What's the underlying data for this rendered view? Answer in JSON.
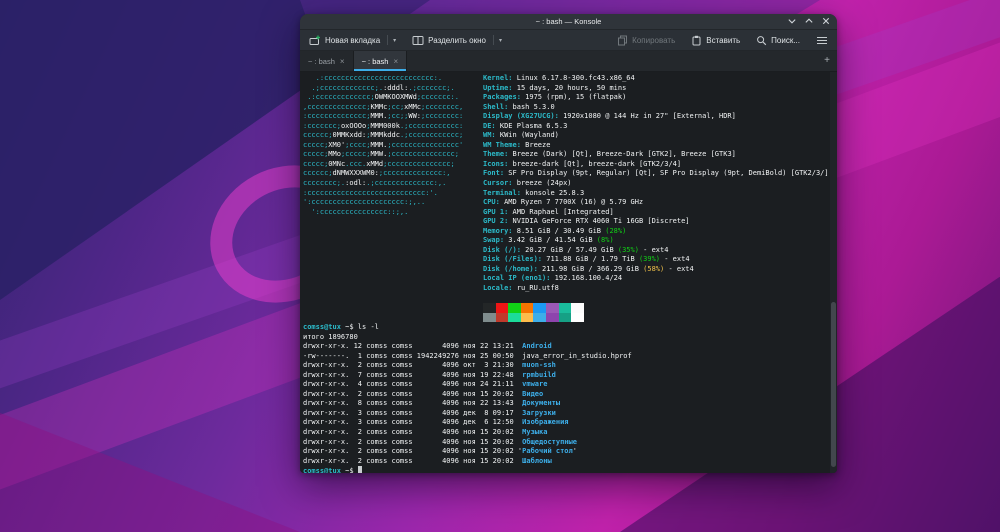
{
  "window": {
    "title": "~ : bash — Konsole"
  },
  "toolbar": {
    "new_tab": "Новая вкладка",
    "split": "Разделить окно",
    "copy": "Копировать",
    "paste": "Вставить",
    "search": "Поиск..."
  },
  "tabs": [
    {
      "label": "~ : bash"
    },
    {
      "label": "~ : bash"
    }
  ],
  "terminal": {
    "colors": {
      "c": "#2cbac9",
      "w": "#f2f4f5",
      "l": "#2cbac9",
      "g": "#11d116",
      "y": "#f0c24b",
      "d": "#3daee9",
      "p": "#2cbac9"
    },
    "palette": {
      "normal": [
        "#232627",
        "#ed1515",
        "#11d116",
        "#f67400",
        "#1d99f3",
        "#9b59b6",
        "#1abc9c",
        "#fcfcfc"
      ],
      "bright": [
        "#7f8c8d",
        "#c0392b",
        "#1cdc9a",
        "#fdbc4b",
        "#3daee9",
        "#8e44ad",
        "#16a085",
        "#ffffff"
      ]
    },
    "art": [
      [
        [
          "c",
          "   .:cccccccccccccccccccccccccc:."
        ]
      ],
      [
        [
          "c",
          "  .;ccccccccccccc;."
        ],
        [
          "w",
          ":dddl:"
        ],
        [
          "c",
          ".;ccccccc;."
        ]
      ],
      [
        [
          "c",
          " .:ccccccccccccc;"
        ],
        [
          "w",
          "OWMKOOXMWd"
        ],
        [
          "c",
          ";ccccccc:."
        ]
      ],
      [
        [
          "c",
          ",cccccccccccccc;"
        ],
        [
          "w",
          "KMMc"
        ],
        [
          "c",
          ";cc;"
        ],
        [
          "w",
          "xMMc"
        ],
        [
          "c",
          ";cccccccc,"
        ]
      ],
      [
        [
          "c",
          ":cccccccccccccc;"
        ],
        [
          "w",
          "MMM."
        ],
        [
          "c",
          ";cc;;"
        ],
        [
          "w",
          "WW:"
        ],
        [
          "c",
          ";cccccccc:"
        ]
      ],
      [
        [
          "c",
          ":ccccccc;"
        ],
        [
          "w",
          "oxOOOo"
        ],
        [
          "c",
          ";"
        ],
        [
          "w",
          "MMM000k"
        ],
        [
          "c",
          ".;cccccccccccc:"
        ]
      ],
      [
        [
          "c",
          "cccccc;"
        ],
        [
          "w",
          "0MMKxdd:"
        ],
        [
          "c",
          ";"
        ],
        [
          "w",
          "MMMkddc"
        ],
        [
          "c",
          ".;cccccccccccc;"
        ]
      ],
      [
        [
          "c",
          "ccccc;"
        ],
        [
          "w",
          "XM0'"
        ],
        [
          "c",
          ";cccc;"
        ],
        [
          "w",
          "MMM."
        ],
        [
          "c",
          ";cccccccccccccccc'"
        ]
      ],
      [
        [
          "c",
          "ccccc;"
        ],
        [
          "w",
          "MMo"
        ],
        [
          "c",
          ";ccccc;"
        ],
        [
          "w",
          "MMW."
        ],
        [
          "c",
          ";ccccccccccccccc;"
        ]
      ],
      [
        [
          "c",
          "ccccc;"
        ],
        [
          "w",
          "0MNc"
        ],
        [
          "c",
          ".ccc."
        ],
        [
          "w",
          "xMMd"
        ],
        [
          "c",
          ";ccccccccccccccc;"
        ]
      ],
      [
        [
          "c",
          "cccccc;"
        ],
        [
          "w",
          "dNMWXXXWM0:"
        ],
        [
          "c",
          ";cccccccccccccc:,"
        ]
      ],
      [
        [
          "c",
          "cccccccc;."
        ],
        [
          "w",
          ":odl:"
        ],
        [
          "c",
          ".;cccccccccccccc:,."
        ]
      ],
      [
        [
          "c",
          ":cccccccccccccccccccccccccccc:'."
        ]
      ],
      [
        [
          "c",
          "':cccccccccccccccccccccc:;,.."
        ]
      ],
      [
        [
          "c",
          "  ':cccccccccccccccc::;,."
        ]
      ]
    ],
    "info": [
      [
        [
          "l",
          "Kernel:"
        ],
        [
          "w",
          " Linux 6.17.8-300.fc43.x86_64"
        ]
      ],
      [
        [
          "l",
          "Uptime:"
        ],
        [
          "w",
          " 15 days, 20 hours, 50 mins"
        ]
      ],
      [
        [
          "l",
          "Packages:"
        ],
        [
          "w",
          " 1975 (rpm), 15 (flatpak)"
        ]
      ],
      [
        [
          "l",
          "Shell:"
        ],
        [
          "w",
          " bash 5.3.0"
        ]
      ],
      [
        [
          "l",
          "Display (XG27UCG):"
        ],
        [
          "w",
          " 1920x1080 @ 144 Hz in 27\" [External, HDR]"
        ]
      ],
      [
        [
          "l",
          "DE:"
        ],
        [
          "w",
          " KDE Plasma 6.5.3"
        ]
      ],
      [
        [
          "l",
          "WM:"
        ],
        [
          "w",
          " KWin (Wayland)"
        ]
      ],
      [
        [
          "l",
          "WM Theme:"
        ],
        [
          "w",
          " Breeze"
        ]
      ],
      [
        [
          "l",
          "Theme:"
        ],
        [
          "w",
          " Breeze (Dark) [Qt], Breeze-Dark [GTK2], Breeze [GTK3]"
        ]
      ],
      [
        [
          "l",
          "Icons:"
        ],
        [
          "w",
          " breeze-dark [Qt], breeze-dark [GTK2/3/4]"
        ]
      ],
      [
        [
          "l",
          "Font:"
        ],
        [
          "w",
          " SF Pro Display (9pt, Regular) [Qt], SF Pro Display (9pt, DemiBold) [GTK2/3/]"
        ]
      ],
      [
        [
          "l",
          "Cursor:"
        ],
        [
          "w",
          " breeze (24px)"
        ]
      ],
      [
        [
          "l",
          "Terminal:"
        ],
        [
          "w",
          " konsole 25.8.3"
        ]
      ],
      [
        [
          "l",
          "CPU:"
        ],
        [
          "w",
          " AMD Ryzen 7 7700X (16) @ 5.79 GHz"
        ]
      ],
      [
        [
          "l",
          "GPU 1:"
        ],
        [
          "w",
          " AMD Raphael [Integrated]"
        ]
      ],
      [
        [
          "l",
          "GPU 2:"
        ],
        [
          "w",
          " NVIDIA GeForce RTX 4060 Ti 16GB [Discrete]"
        ]
      ],
      [
        [
          "l",
          "Memory:"
        ],
        [
          "w",
          " 8.51 GiB / 30.49 GiB "
        ],
        [
          "g",
          "(28%)"
        ]
      ],
      [
        [
          "l",
          "Swap:"
        ],
        [
          "w",
          " 3.42 GiB / 41.54 GiB "
        ],
        [
          "g",
          "(8%)"
        ]
      ],
      [
        [
          "l",
          "Disk (/):"
        ],
        [
          "w",
          " 20.27 GiB / 57.49 GiB "
        ],
        [
          "g",
          "(35%)"
        ],
        [
          "w",
          " - ext4"
        ]
      ],
      [
        [
          "l",
          "Disk (/Files):"
        ],
        [
          "w",
          " 711.88 GiB / 1.79 TiB "
        ],
        [
          "g",
          "(39%)"
        ],
        [
          "w",
          " - ext4"
        ]
      ],
      [
        [
          "l",
          "Disk (/home):"
        ],
        [
          "w",
          " 211.98 GiB / 366.29 GiB "
        ],
        [
          "y",
          "(58%)"
        ],
        [
          "w",
          " - ext4"
        ]
      ],
      [
        [
          "l",
          "Local IP (eno1):"
        ],
        [
          "w",
          " 192.168.100.4/24"
        ]
      ],
      [
        [
          "l",
          "Locale:"
        ],
        [
          "w",
          " ru_RU.utf8"
        ]
      ],
      [],
      [
        [
          "P1",
          ""
        ]
      ],
      [
        [
          "P2",
          ""
        ]
      ]
    ],
    "shell": [
      [
        [
          "p",
          "comss@tux"
        ],
        [
          "w",
          " ~$ ls -l"
        ]
      ],
      [
        [
          "w",
          "итого 1896780"
        ]
      ],
      [
        [
          "w",
          "drwxr-xr-x. 12 comss comss       4096 ноя 22 13:21  "
        ],
        [
          "d",
          "Android"
        ]
      ],
      [
        [
          "w",
          "-rw-------.  1 comss comss 1942249276 ноя 25 00:50  java_error_in_studio.hprof"
        ]
      ],
      [
        [
          "w",
          "drwxr-xr-x.  2 comss comss       4096 окт  3 21:30  "
        ],
        [
          "d",
          "muon-ssh"
        ]
      ],
      [
        [
          "w",
          "drwxr-xr-x.  7 comss comss       4096 ноя 19 22:48  "
        ],
        [
          "d",
          "rpmbuild"
        ]
      ],
      [
        [
          "w",
          "drwxr-xr-x.  4 comss comss       4096 ноя 24 21:11  "
        ],
        [
          "d",
          "vmware"
        ]
      ],
      [
        [
          "w",
          "drwxr-xr-x.  2 comss comss       4096 ноя 15 20:02  "
        ],
        [
          "d",
          "Видео"
        ]
      ],
      [
        [
          "w",
          "drwxr-xr-x.  8 comss comss       4096 ноя 22 13:43  "
        ],
        [
          "d",
          "Документы"
        ]
      ],
      [
        [
          "w",
          "drwxr-xr-x.  3 comss comss       4096 дек  8 09:17  "
        ],
        [
          "d",
          "Загрузки"
        ]
      ],
      [
        [
          "w",
          "drwxr-xr-x.  3 comss comss       4096 дек  6 12:50  "
        ],
        [
          "d",
          "Изображения"
        ]
      ],
      [
        [
          "w",
          "drwxr-xr-x.  2 comss comss       4096 ноя 15 20:02  "
        ],
        [
          "d",
          "Музыка"
        ]
      ],
      [
        [
          "w",
          "drwxr-xr-x.  2 comss comss       4096 ноя 15 20:02  "
        ],
        [
          "d",
          "Общедоступные"
        ]
      ],
      [
        [
          "w",
          "drwxr-xr-x.  2 comss comss       4096 ноя 15 20:02 '"
        ],
        [
          "d",
          "Рабочий стол"
        ],
        [
          "w",
          "'"
        ]
      ],
      [
        [
          "w",
          "drwxr-xr-x.  2 comss comss       4096 ноя 15 20:02  "
        ],
        [
          "d",
          "Шаблоны"
        ]
      ],
      [
        [
          "p",
          "comss@tux"
        ],
        [
          "w",
          " ~$ "
        ],
        [
          "K",
          ""
        ]
      ]
    ]
  }
}
